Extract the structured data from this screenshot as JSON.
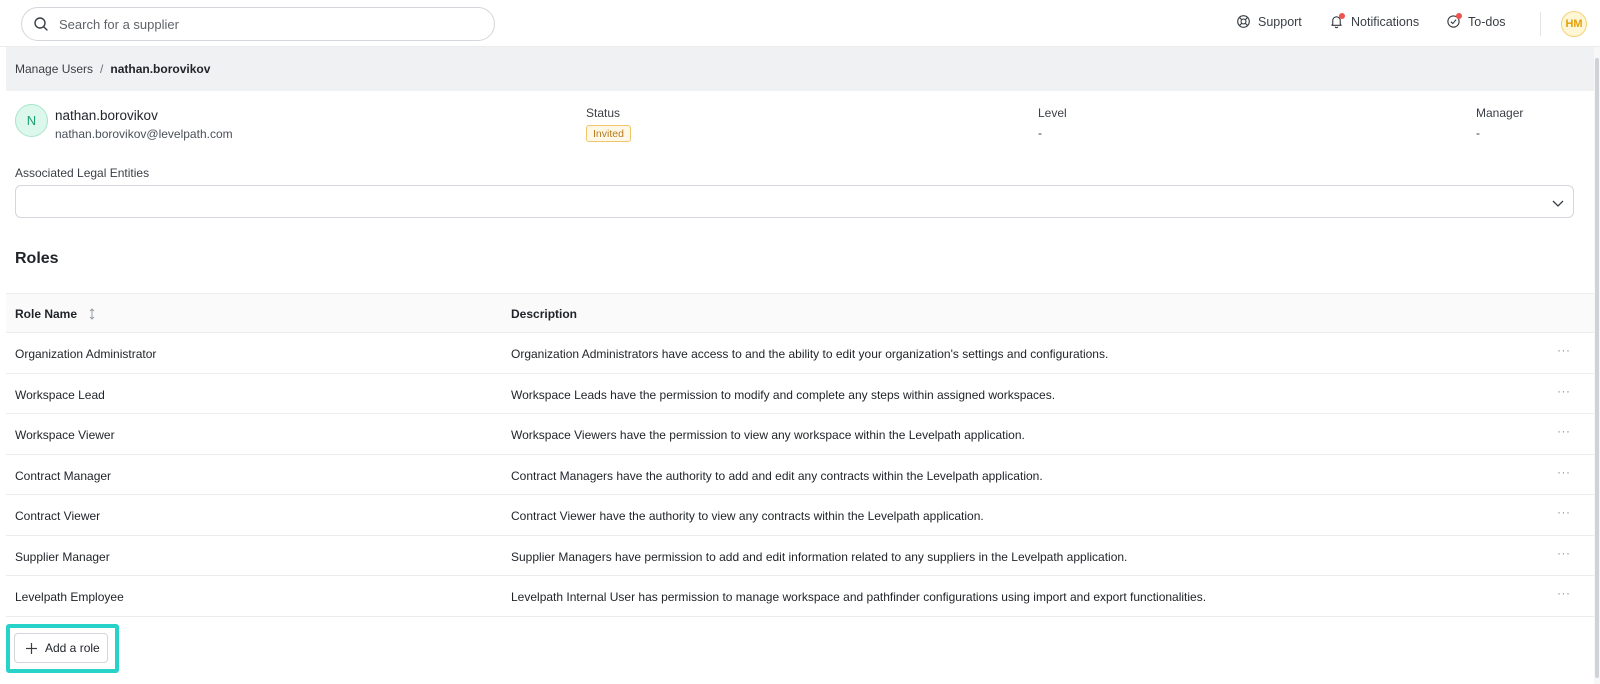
{
  "search": {
    "placeholder": "Search for a supplier"
  },
  "topnav": {
    "support": "Support",
    "notifications": "Notifications",
    "todos": "To-dos",
    "avatar_initials": "HM",
    "notification_dot_color": "#ef5350"
  },
  "breadcrumb": {
    "parent": "Manage Users",
    "separator": "/",
    "current": "nathan.borovikov"
  },
  "user": {
    "initial": "N",
    "username": "nathan.borovikov",
    "email": "nathan.borovikov@levelpath.com",
    "status_label": "Status",
    "status_value": "Invited",
    "level_label": "Level",
    "level_value": "-",
    "manager_label": "Manager",
    "manager_value": "-"
  },
  "legal_entities": {
    "label": "Associated Legal Entities",
    "value": ""
  },
  "roles": {
    "title": "Roles",
    "columns": {
      "role_name": "Role Name",
      "description": "Description"
    },
    "row_menu": "···",
    "items": [
      {
        "name": "Organization Administrator",
        "description": "Organization Administrators have access to and the ability to edit your organization's settings and configurations."
      },
      {
        "name": "Workspace Lead",
        "description": "Workspace Leads have the permission to modify and complete any steps within assigned workspaces."
      },
      {
        "name": "Workspace Viewer",
        "description": "Workspace Viewers have the permission to view any workspace within the Levelpath application."
      },
      {
        "name": "Contract Manager",
        "description": "Contract Managers have the authority to add and edit any contracts within the Levelpath application."
      },
      {
        "name": "Contract Viewer",
        "description": "Contract Viewer have the authority to view any contracts within the Levelpath application."
      },
      {
        "name": "Supplier Manager",
        "description": "Supplier Managers have permission to add and edit information related to any suppliers in the Levelpath application."
      },
      {
        "name": "Levelpath Employee",
        "description": "Levelpath Internal User has permission to manage workspace and pathfinder configurations using import and export functionalities."
      }
    ],
    "add_label": "Add a role"
  },
  "colors": {
    "highlight": "#27d2c8",
    "badge_invited": "#b7791f",
    "avatar_user": "#1e9e6a",
    "avatar_hm": "#e3a006"
  }
}
